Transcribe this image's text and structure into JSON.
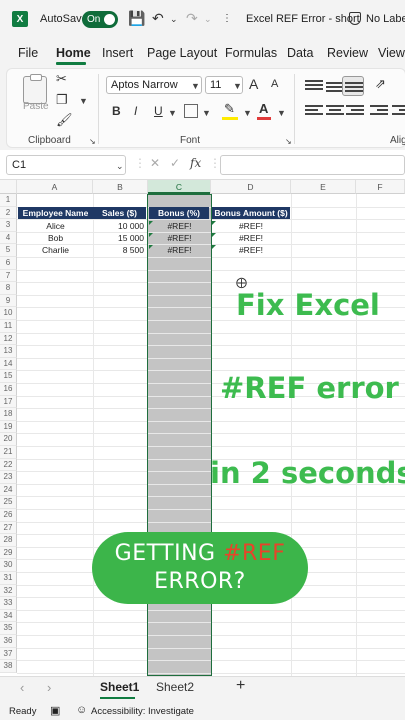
{
  "titlebar": {
    "autosave_label": "AutoSave",
    "autosave_state": "On",
    "document_title": "Excel REF Error - short",
    "sensitivity_label": "No Label"
  },
  "tabs": [
    "File",
    "Home",
    "Insert",
    "Page Layout",
    "Formulas",
    "Data",
    "Review",
    "View"
  ],
  "ribbon": {
    "paste_label": "Paste",
    "clipboard_group": "Clipboard",
    "font_group": "Font",
    "alignment_group": "Alig",
    "font_name": "Aptos Narrow",
    "font_size": "11",
    "bold": "B",
    "italic": "I",
    "underline": "U",
    "grow_font": "A",
    "shrink_font": "A"
  },
  "formula_bar": {
    "name_box": "C1",
    "fx": "fx",
    "formula": ""
  },
  "columns": [
    "A",
    "B",
    "C",
    "D",
    "E",
    "F"
  ],
  "rows": [
    "1",
    "2",
    "3",
    "4",
    "5",
    "6",
    "7",
    "8",
    "9",
    "10",
    "11",
    "12",
    "13",
    "14",
    "15",
    "16",
    "17",
    "18",
    "19",
    "20",
    "21",
    "22",
    "23",
    "24",
    "25",
    "26",
    "27",
    "28",
    "29",
    "30",
    "31",
    "32",
    "33",
    "34",
    "35",
    "36",
    "37",
    "38"
  ],
  "table": {
    "headers": [
      "Employee Name",
      "Sales ($)",
      "Bonus (%)",
      "Bonus Amount ($)"
    ],
    "rows": [
      [
        "Alice",
        "10 000",
        "#REF!",
        "#REF!"
      ],
      [
        "Bob",
        "15 000",
        "#REF!",
        "#REF!"
      ],
      [
        "Charlie",
        "8 500",
        "#REF!",
        "#REF!"
      ]
    ]
  },
  "overlay": {
    "line1": "Fix Excel",
    "line2": "#REF error",
    "line3": "in 2 seconds",
    "pill_prefix": "GETTING ",
    "pill_ref": "#REF",
    "pill_line2": "ERROR?"
  },
  "sheets": [
    "Sheet1",
    "Sheet2"
  ],
  "add_sheet": "+",
  "status": {
    "ready": "Ready",
    "accessibility": "Accessibility: Investigate"
  },
  "colors": {
    "excel_green": "#107c41",
    "overlay_green": "#3dbb4f",
    "header_navy": "#1f3864",
    "ref_red": "#e8432a"
  }
}
